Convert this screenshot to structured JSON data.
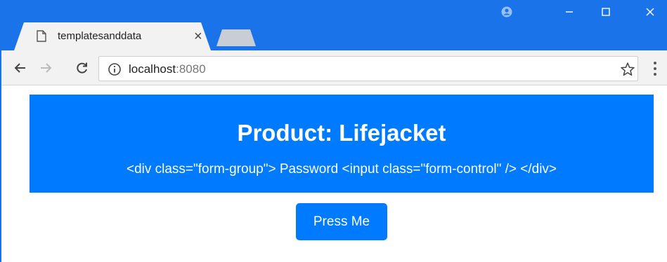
{
  "browser": {
    "tab_title": "templatesanddata",
    "close_glyph": "×",
    "url_host": "localhost",
    "url_port": ":8080",
    "accent": "#1a73e8"
  },
  "page": {
    "title": "Product: Lifejacket",
    "raw_markup": "<div class=\"form-group\"> Password <input class=\"form-control\" /> </div>",
    "button_label": "Press Me",
    "accent": "#007bff"
  }
}
